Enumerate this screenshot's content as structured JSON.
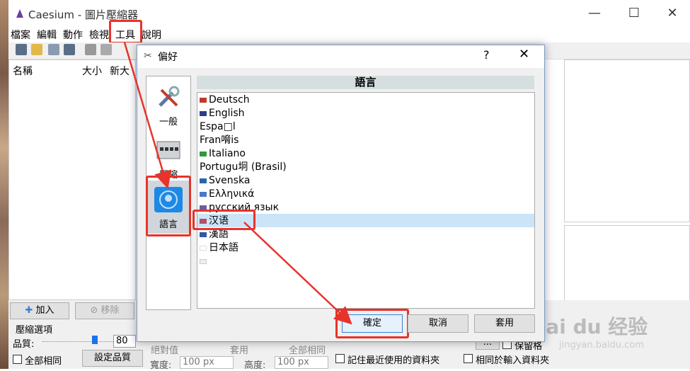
{
  "app": {
    "title": "Caesium - 圖片壓縮器"
  },
  "menu": [
    "檔案",
    "編輯",
    "動作",
    "檢視",
    "工具",
    "說明"
  ],
  "file_list": {
    "columns": [
      "名稱",
      "大小",
      "新大"
    ]
  },
  "bottom": {
    "add": "加入",
    "remove": "移除",
    "compress_options": "壓縮選項",
    "quality_label": "品質:",
    "quality_value": "80",
    "all_same": "全部相同",
    "set_quality": "設定品質",
    "width_label": "寬度:",
    "width_value": "100 px",
    "height_label": "高度:",
    "height_value": "100 px",
    "remember_folder": "記住最近使用的資料夾",
    "same_as_input": "相同於輸入資料夾",
    "keep_label": "保留格",
    "ellipsis": "...",
    "faded_absolute": "絕對值",
    "faded_apply": "套用",
    "faded_allsame": "全部相同"
  },
  "dialog": {
    "title": "偏好",
    "help": "?",
    "close": "✕",
    "sidebar": [
      {
        "label": "一般",
        "icon": "tools-icon"
      },
      {
        "label": "壓縮",
        "icon": "compress-icon"
      },
      {
        "label": "語言",
        "icon": "globe-icon"
      }
    ],
    "section_header": "語言",
    "languages": [
      {
        "name": "Deutsch",
        "flag": "#c0392b"
      },
      {
        "name": "English",
        "flag": "#2c3e8a"
      },
      {
        "name": "Espa□l",
        "flag": ""
      },
      {
        "name": "Fran嗋is",
        "flag": ""
      },
      {
        "name": "Italiano",
        "flag": "#2e9a3a"
      },
      {
        "name": "Portugu坰 (Brasil)",
        "flag": ""
      },
      {
        "name": "Svenska",
        "flag": "#2a66b0"
      },
      {
        "name": "Ελληνικά",
        "flag": "#4a77c9"
      },
      {
        "name": "русский язык",
        "flag": "#6b5fa0"
      },
      {
        "name": "汉语",
        "flag": "#b0506a"
      },
      {
        "name": "漢語",
        "flag": "#3355aa"
      },
      {
        "name": "日本語",
        "flag": "#e52e2e"
      }
    ],
    "ok": "確定",
    "cancel": "取消",
    "apply": "套用"
  },
  "watermark": {
    "main": "Bai du 经验",
    "sub": "jingyan.baidu.com"
  }
}
